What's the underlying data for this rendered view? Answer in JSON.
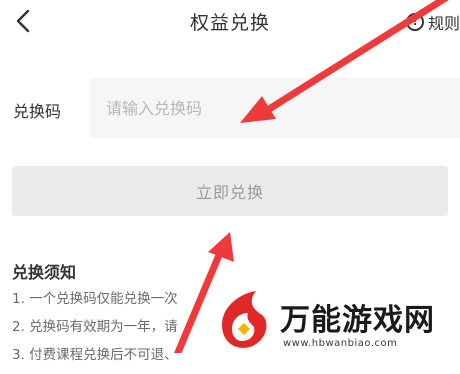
{
  "header": {
    "title": "权益兑换",
    "rules_label": "规则",
    "rules_icon": "!"
  },
  "form": {
    "code_label": "兑换码",
    "code_placeholder": "请输入兑换码",
    "code_value": "",
    "submit_label": "立即兑换"
  },
  "notice": {
    "title": "兑换须知",
    "items": [
      "1. 一个兑换码仅能兑换一次",
      "2. 兑换码有效期为一年，请",
      "3. 付费课程兑换后不可退、"
    ]
  },
  "watermark": {
    "name": "万能游戏网",
    "url": "www.hbwanbiao.com"
  },
  "colors": {
    "arrow": "#ee3a3a",
    "input_bg": "#f6f6f6",
    "button_bg": "#ebebeb",
    "button_text": "#9a9a9a"
  },
  "icons": {
    "back": "chevron-left-icon",
    "rules": "info-icon"
  }
}
